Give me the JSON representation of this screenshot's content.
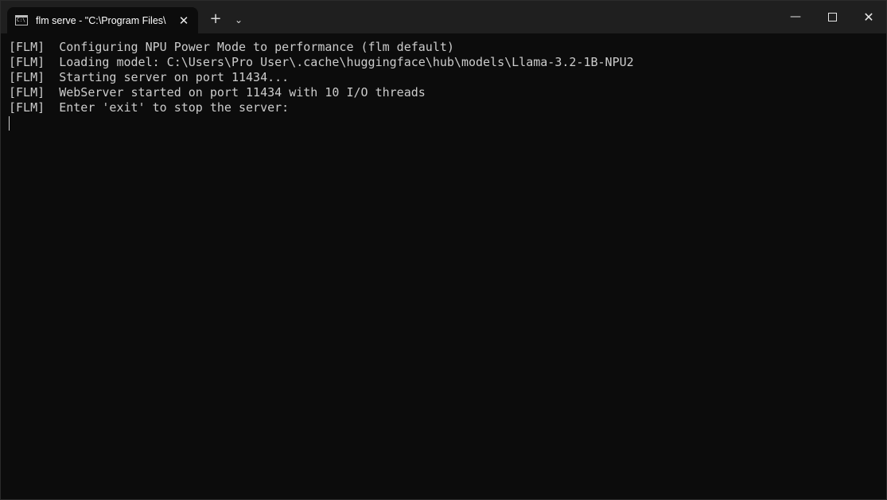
{
  "titlebar": {
    "tab": {
      "icon": "terminal-icon",
      "title": "flm serve - \"C:\\Program Files\\",
      "close_glyph": "✕"
    },
    "new_tab_glyph": "+",
    "dropdown_glyph": "⌄",
    "window_controls": {
      "minimize_glyph": "—",
      "close_glyph": "✕"
    }
  },
  "terminal": {
    "lines": [
      "[FLM]  Configuring NPU Power Mode to performance (flm default)",
      "[FLM]  Loading model: C:\\Users\\Pro User\\.cache\\huggingface\\hub\\models\\Llama-3.2-1B-NPU2",
      "[FLM]  Starting server on port 11434...",
      "[FLM]  WebServer started on port 11434 with 10 I/O threads",
      "[FLM]  Enter 'exit' to stop the server:"
    ],
    "colors": {
      "background": "#0c0c0c",
      "foreground": "#cccccc",
      "titlebar": "#1f1f1f"
    }
  }
}
